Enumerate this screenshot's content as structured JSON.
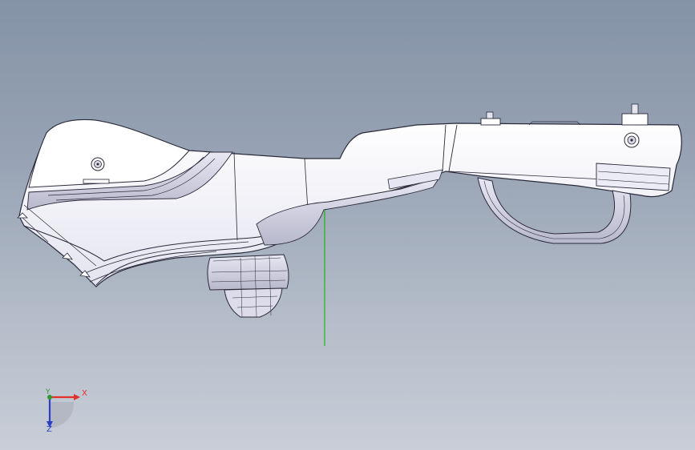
{
  "viewport": {
    "background_top": "#8593a7",
    "background_bottom": "#c9ced8"
  },
  "model": {
    "fill": "#f7f7fb",
    "edge_color": "#2a2a3a",
    "shade": "#c8c8dc",
    "axis_line_color": "#1fb31f"
  },
  "triad": {
    "x_label": "X",
    "y_label": "Y",
    "z_label": "Z",
    "x_color": "#e0332b",
    "y_color": "#2f9a2f",
    "z_color": "#2b3fc4"
  }
}
